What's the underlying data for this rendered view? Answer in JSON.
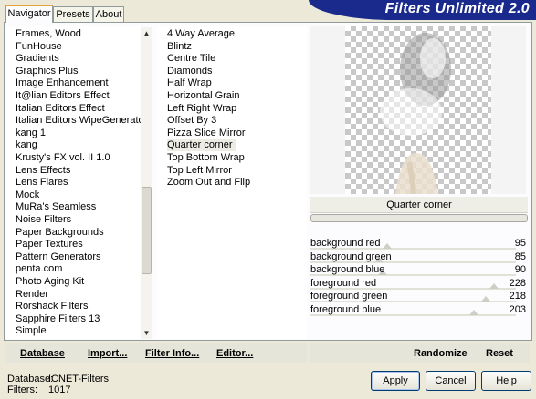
{
  "banner": {
    "title": "Filters Unlimited 2.0"
  },
  "tabs": [
    {
      "label": "Navigator",
      "active": true
    },
    {
      "label": "Presets",
      "active": false
    },
    {
      "label": "About",
      "active": false
    }
  ],
  "categories": [
    "Frames, Wood",
    "FunHouse",
    "Gradients",
    "Graphics Plus",
    "Image Enhancement",
    "It@lian Editors Effect",
    "Italian Editors Effect",
    "Italian Editors WipeGenerator",
    "kang 1",
    "kang",
    "Krusty's FX vol. II 1.0",
    "Lens Effects",
    "Lens Flares",
    "Mock",
    "MuRa's Seamless",
    "Noise Filters",
    "Paper Backgrounds",
    "Paper Textures",
    "Pattern Generators",
    "penta.com",
    "Photo Aging Kit",
    "Render",
    "Rorshack Filters",
    "Sapphire Filters 13",
    "Simple"
  ],
  "filters": [
    "4 Way Average",
    "Blintz",
    "Centre Tile",
    "Diamonds",
    "Half Wrap",
    "Horizontal Grain",
    "Left Right Wrap",
    "Offset By 3",
    "Pizza Slice Mirror",
    "Quarter corner",
    "Top Bottom Wrap",
    "Top Left Mirror",
    "Zoom Out and Flip"
  ],
  "selected_filter_index": 9,
  "icons": {
    "scroll_up": "▲",
    "scroll_down": "▼"
  },
  "preview": {
    "filter_name": "Quarter corner"
  },
  "params": [
    {
      "name": "background red",
      "value": "95",
      "level": 0.373
    },
    {
      "name": "background green",
      "value": "85",
      "level": 0.333
    },
    {
      "name": "background blue",
      "value": "90",
      "level": 0.353
    },
    {
      "name": "foreground red",
      "value": "228",
      "level": 0.894
    },
    {
      "name": "foreground green",
      "value": "218",
      "level": 0.855
    },
    {
      "name": "foreground blue",
      "value": "203",
      "level": 0.796
    }
  ],
  "actions": {
    "database": "Database",
    "import": "Import...",
    "filter_info": "Filter Info...",
    "editor": "Editor...",
    "randomize": "Randomize",
    "reset": "Reset"
  },
  "status": {
    "database_label": "Database:",
    "database_value": "ICNET-Filters",
    "filters_label": "Filters:",
    "filters_value": "1017"
  },
  "buttons": {
    "apply": "Apply",
    "cancel": "Cancel",
    "help": "Help"
  },
  "colors": {
    "banner": "#1a2a8c",
    "window": "#ece9d8",
    "selection": "#ecebe4"
  }
}
